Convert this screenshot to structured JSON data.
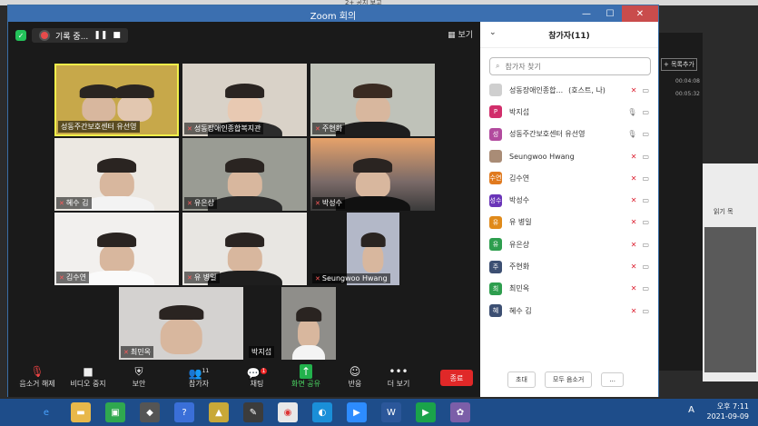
{
  "window": {
    "title": "Zoom 회의",
    "bg_title": "2+ 공지 보고"
  },
  "topbar": {
    "recording_label": "기록 중...",
    "view_label": "보기"
  },
  "grid": {
    "tiles": [
      {
        "name": "성동주간보호센터 유선영",
        "muted": false
      },
      {
        "name": "성동장애인종합복지관",
        "muted": true
      },
      {
        "name": "주현화",
        "muted": true
      },
      {
        "name": "혜수 김",
        "muted": true
      },
      {
        "name": "유은상",
        "muted": true
      },
      {
        "name": "박성수",
        "muted": true
      },
      {
        "name": "김수연",
        "muted": true
      },
      {
        "name": "유 병일",
        "muted": true
      },
      {
        "name": "Seungwoo Hwang",
        "muted": true
      },
      {
        "name": "최민옥",
        "muted": true
      },
      {
        "name": "박지섭",
        "muted": false
      },
      {
        "name": "",
        "muted": false
      }
    ]
  },
  "toolbar": {
    "mute": "음소거 해제",
    "video": "비디오 중지",
    "security": "보안",
    "participants": "참가자",
    "participants_count": "11",
    "chat": "채팅",
    "chat_badge": "1",
    "share": "화면 공유",
    "reactions": "반응",
    "more": "더 보기",
    "end": "종료"
  },
  "panel": {
    "title": "참가자(11)",
    "search_placeholder": "참가자 찾기",
    "participants": [
      {
        "initial": "",
        "name": "성동장애인종합...",
        "suffix": "(호스트, 나)",
        "color": "#cfcfcf"
      },
      {
        "initial": "P",
        "name": "박지섭",
        "suffix": "",
        "color": "#d12e6b"
      },
      {
        "initial": "성",
        "name": "성동주간보호센터 유선영",
        "suffix": "",
        "color": "#b24a9e"
      },
      {
        "initial": "",
        "name": "Seungwoo Hwang",
        "suffix": "",
        "color": "#a98c76"
      },
      {
        "initial": "수연",
        "name": "김수연",
        "suffix": "",
        "color": "#e07a1f"
      },
      {
        "initial": "성수",
        "name": "박성수",
        "suffix": "",
        "color": "#6a35b8"
      },
      {
        "initial": "유",
        "name": "유 병일",
        "suffix": "",
        "color": "#e08a1a"
      },
      {
        "initial": "유",
        "name": "유은상",
        "suffix": "",
        "color": "#2e9e4e"
      },
      {
        "initial": "주",
        "name": "주현화",
        "suffix": "",
        "color": "#3c4f72"
      },
      {
        "initial": "최",
        "name": "최민옥",
        "suffix": "",
        "color": "#2e9e4e"
      },
      {
        "initial": "혜",
        "name": "혜수 김",
        "suffix": "",
        "color": "#3c4f72"
      }
    ],
    "invite": "초대",
    "mute_all": "모두 음소거",
    "more": "..."
  },
  "bg_right": {
    "invite_label": "+ 목록추가",
    "time1": "00:04:08",
    "time2": "00:05:32",
    "read_label": "읽기 목"
  },
  "taskbar": {
    "time": "오후 7:11",
    "date": "2021-09-09",
    "lang": "A"
  }
}
